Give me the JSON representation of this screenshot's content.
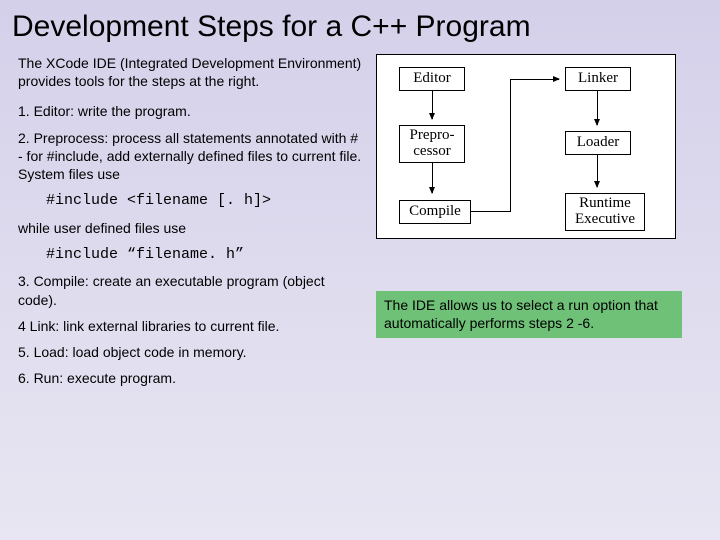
{
  "title": "Development Steps for a C++ Program",
  "intro": "The XCode IDE (Integrated Development Environment) provides tools for the steps at the right.",
  "step1": "1. Editor: write the program.",
  "step2": "2. Preprocess: process all statements annotated with # - for #include, add externally defined files to current file. System files use",
  "code1": "#include <filename [. h]>",
  "user_defined": "while user defined files use",
  "code2": "#include “filename. h”",
  "step3": "3. Compile: create an executable program (object code).",
  "step4": "4 Link: link external libraries to current file.",
  "step5": "5. Load: load object code in memory.",
  "step6": "6. Run: execute program.",
  "diagram": {
    "editor": "Editor",
    "linker": "Linker",
    "preprocessor": "Prepro-\ncessor",
    "loader": "Loader",
    "compile": "Compile",
    "runtime": "Runtime\nExecutive"
  },
  "ide_note": "The IDE allows us to select a run option that automatically performs steps 2 -6."
}
